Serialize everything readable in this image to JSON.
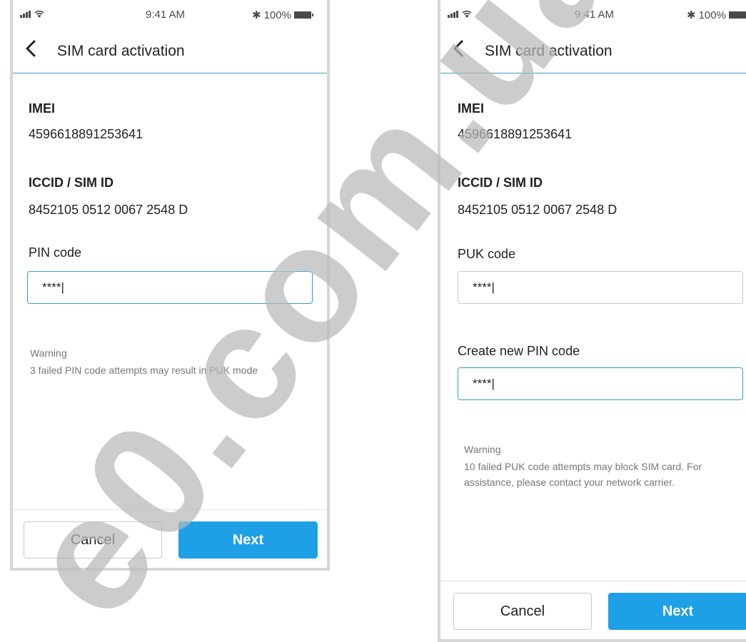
{
  "colors": {
    "accent": "#1ea0e6",
    "divider": "#2d9fd8",
    "watermark": "#b5b5b5"
  },
  "screens": [
    {
      "status": {
        "time": "9:41 AM",
        "battery": "100%"
      },
      "title": "SIM card activation",
      "imei_label": "IMEI",
      "imei_value": "4596618891253641",
      "iccid_label": "ICCID / SIM ID",
      "iccid_value": "8452105 0512 0067 2548 D",
      "input1_label": "PIN code",
      "input1_value": "****|",
      "warning_title": "Warning",
      "warning_text": "3 failed PIN code attempts may result in PUK mode",
      "cancel_label": "Cancel",
      "next_label": "Next"
    },
    {
      "status": {
        "time": "9:41 AM",
        "battery": "100%"
      },
      "title": "SIM card activation",
      "imei_label": "IMEI",
      "imei_value": "4596618891253641",
      "iccid_label": "ICCID / SIM ID",
      "iccid_value": "8452105 0512 0067 2548 D",
      "input1_label": "PUK code",
      "input1_value": "****|",
      "input2_label": "Create new PIN code",
      "input2_value": "****|",
      "warning_title": "Warning",
      "warning_text_line1": "10 failed PUK code attempts may block SIM card. For",
      "warning_text_line2": "assistance, please contact your network carrier.",
      "cancel_label": "Cancel",
      "next_label": "Next"
    }
  ],
  "watermark_text": "e0.com.ua"
}
